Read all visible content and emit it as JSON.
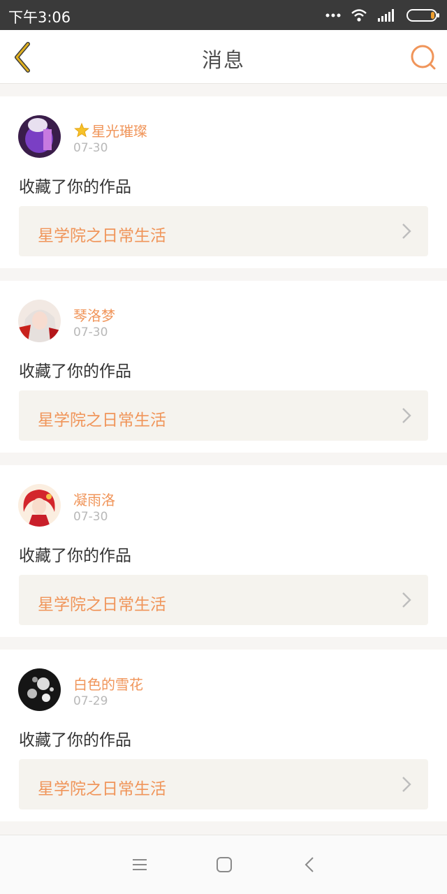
{
  "status_bar": {
    "time": "下午3:06"
  },
  "header": {
    "title": "消息",
    "back_icon": "chevron-left-icon",
    "search_icon": "search-icon"
  },
  "messages": [
    {
      "user": "星光璀璨",
      "badge": "star-icon",
      "date": "07-30",
      "action": "收藏了你的作品",
      "work": "星学院之日常生活"
    },
    {
      "user": "琴洛梦",
      "date": "07-30",
      "action": "收藏了你的作品",
      "work": "星学院之日常生活"
    },
    {
      "user": "凝雨洛",
      "date": "07-30",
      "action": "收藏了你的作品",
      "work": "星学院之日常生活"
    },
    {
      "user": "白色的雪花",
      "date": "07-29",
      "action": "收藏了你的作品",
      "work": "星学院之日常生活"
    }
  ],
  "colors": {
    "accent": "#f0955a",
    "back_icon": "#e0b020",
    "status_bar_bg": "#3a3a3a"
  },
  "nav_bar": {
    "menu_icon": "menu-icon",
    "home_icon": "home-square-icon",
    "back_icon": "back-triangle-icon"
  }
}
